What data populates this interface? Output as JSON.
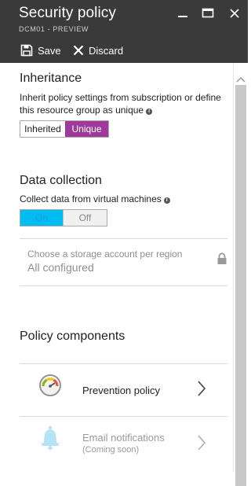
{
  "header": {
    "title": "Security policy",
    "subtitle": "DCM01 - PREVIEW",
    "toolbar": {
      "save_label": "Save",
      "discard_label": "Discard"
    }
  },
  "inheritance": {
    "title": "Inheritance",
    "description_line1": "Inherit policy settings from subscription or define",
    "description_line2": "this resource group as unique",
    "options": [
      "Inherited",
      "Unique"
    ],
    "selected": "Unique"
  },
  "data_collection": {
    "title": "Data collection",
    "description": "Collect data from virtual machines",
    "options": [
      "On",
      "Off"
    ],
    "selected": "On"
  },
  "storage": {
    "label": "Choose a storage account per region",
    "value": "All configured"
  },
  "policy_components": {
    "title": "Policy components",
    "items": [
      {
        "label": "Prevention policy",
        "sublabel": "",
        "icon": "gauge-icon",
        "enabled": true
      },
      {
        "label": "Email notifications",
        "sublabel": "(Coming soon)",
        "icon": "bell-icon",
        "enabled": false
      }
    ]
  },
  "colors": {
    "header_bg": "#3a3a3a",
    "unique_accent": "#a03a9a",
    "on_accent": "#00bcf2"
  }
}
